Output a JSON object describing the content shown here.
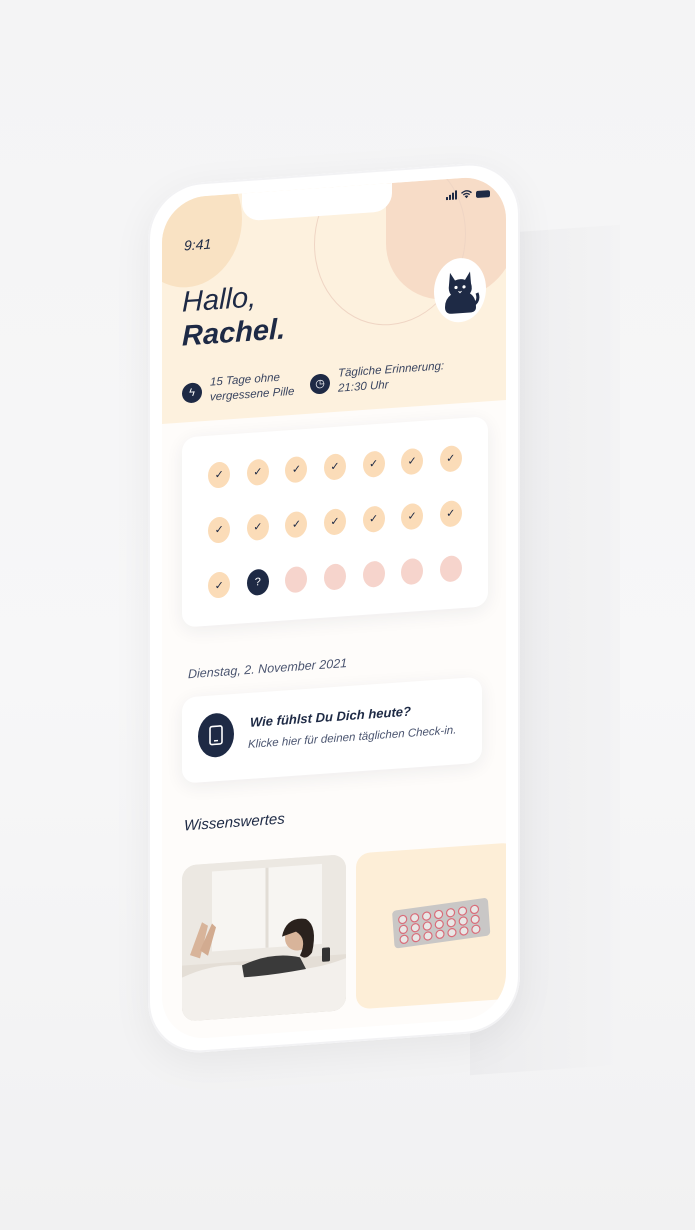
{
  "status_bar": {
    "time": "9:41"
  },
  "greeting": {
    "hello": "Hallo,",
    "name": "Rachel."
  },
  "stats": [
    {
      "icon": "lightning-icon",
      "text": "15 Tage ohne vergessene Pille"
    },
    {
      "icon": "clock-icon",
      "text": "Tägliche Erinnerung: 21:30 Uhr"
    }
  ],
  "pill_calendar": {
    "taken_count": 15,
    "today_symbol": "?",
    "remaining_count": 5,
    "check_symbol": "✓"
  },
  "date": "Dienstag, 2. November 2021",
  "checkin": {
    "title": "Wie fühlst Du Dich heute?",
    "subtitle": "Klicke hier für deinen täglichen Check-in."
  },
  "section_title": "Wissenswertes",
  "colors": {
    "navy": "#1e2a45",
    "peach": "#fdf1de",
    "pill_done": "#fbdcb8",
    "pill_future": "#f6d4cc"
  }
}
